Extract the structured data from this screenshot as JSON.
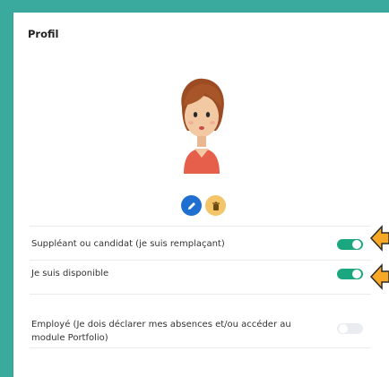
{
  "profile": {
    "title": "Profil",
    "avatar_icon": "avatar-girl-icon",
    "edit_icon": "pencil-icon",
    "delete_icon": "trash-icon"
  },
  "settings": [
    {
      "label": "Suppléant ou candidat (je suis remplaçant)",
      "enabled": true
    },
    {
      "label": "Je suis disponible",
      "enabled": true
    },
    {
      "label": "Employé (Je dois déclarer mes absences et/ou accéder au module Portfolio)",
      "enabled": false
    }
  ],
  "colors": {
    "background": "#3aaa9f",
    "toggle_on": "#1aa67e",
    "toggle_off": "#e9edf1",
    "edit_button": "#1f6fd1",
    "delete_button": "#f3c468",
    "pointer_arrow": "#f7a826"
  }
}
